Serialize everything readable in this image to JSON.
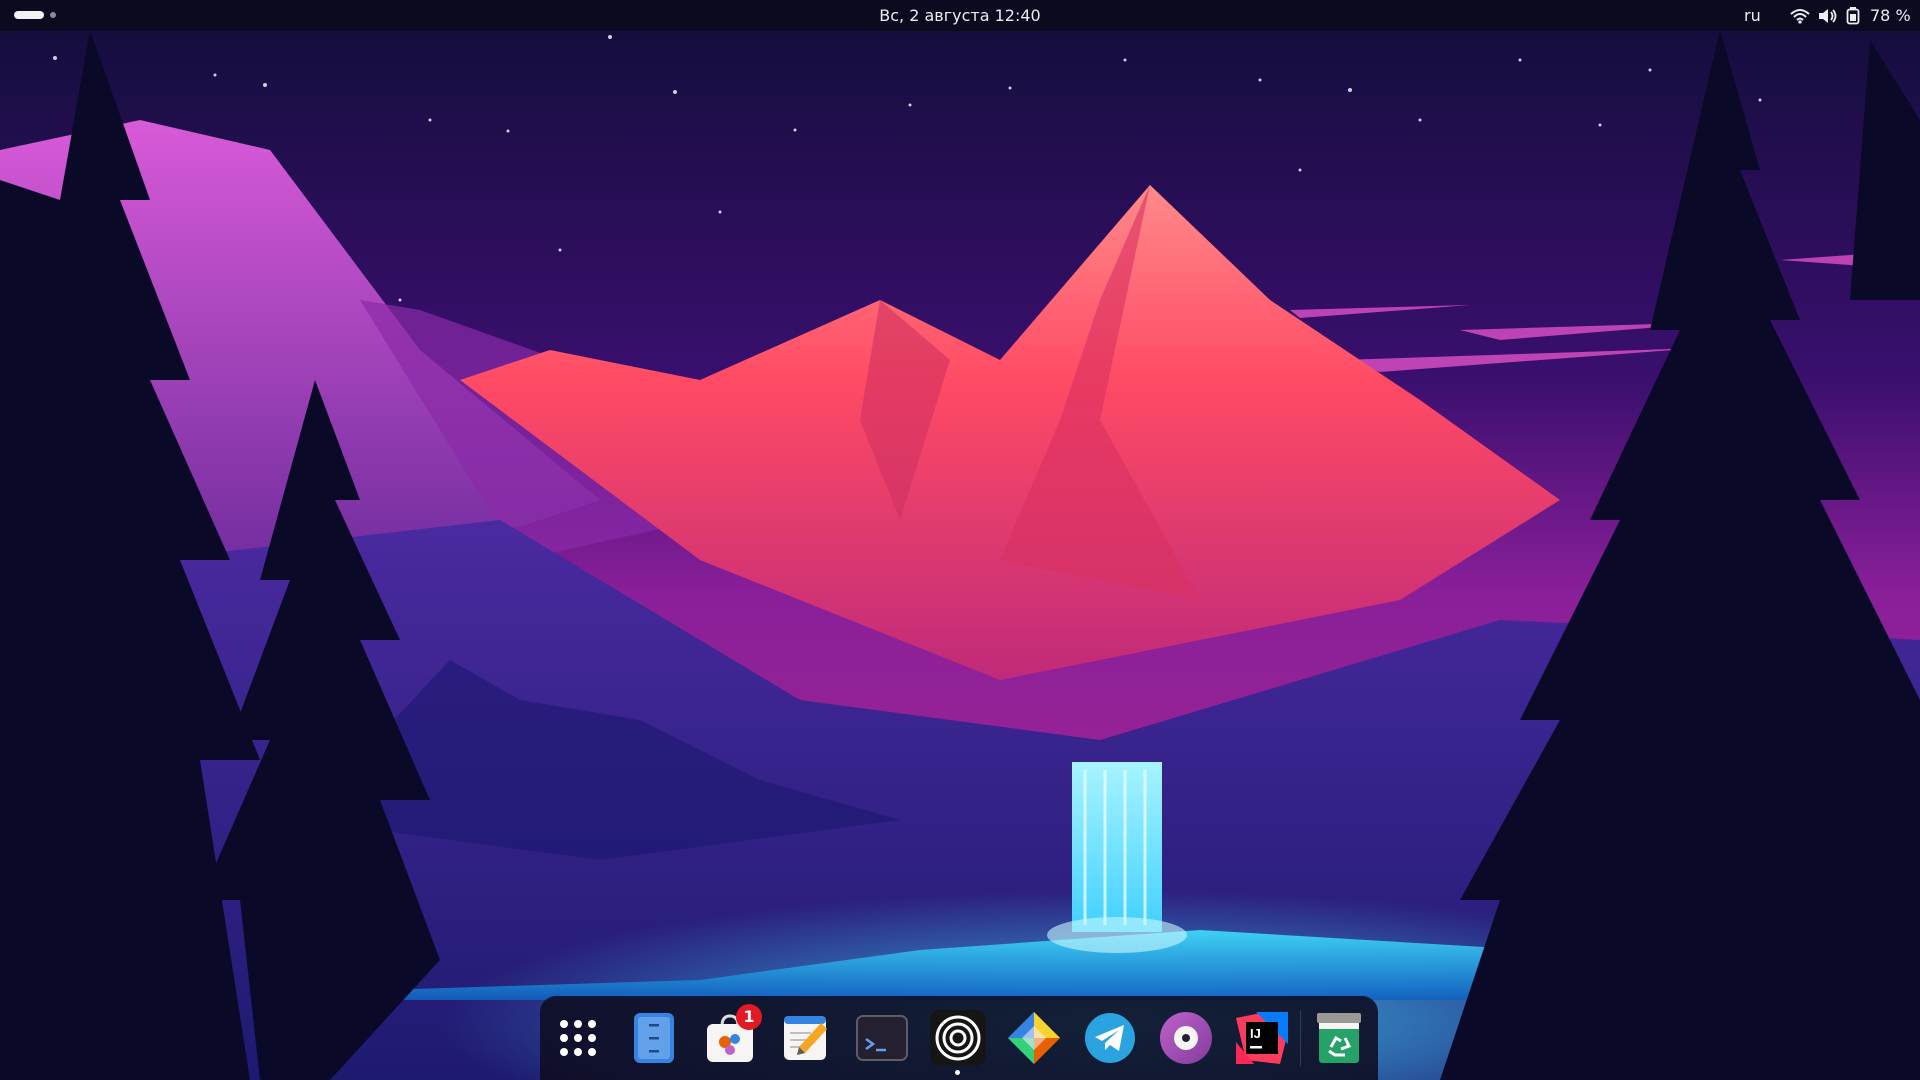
{
  "topbar": {
    "datetime": "Вс, 2 августа  12:40",
    "language": "ru",
    "battery_percent": "78 %",
    "workspaces": {
      "count": 2,
      "active": 1
    }
  },
  "wallpaper": {
    "description_colors": {
      "sky": "#2a0a5a",
      "mountain": "#f0405a",
      "water": "#20c8ff",
      "trees": "#0a0a25"
    }
  },
  "dock": {
    "apps": [
      {
        "name": "app-grid",
        "icon": "app-grid-icon"
      },
      {
        "name": "files",
        "icon": "files-icon"
      },
      {
        "name": "software-center",
        "icon": "store-bag-icon",
        "badge": "1"
      },
      {
        "name": "text-editor",
        "icon": "notepad-pencil-icon"
      },
      {
        "name": "terminal",
        "icon": "terminal-icon"
      },
      {
        "name": "obs-studio",
        "icon": "concentric-rings-icon",
        "running": true
      },
      {
        "name": "sketch-like-app",
        "icon": "gem-icon"
      },
      {
        "name": "telegram",
        "icon": "telegram-icon"
      },
      {
        "name": "music-player",
        "icon": "vinyl-disc-icon"
      },
      {
        "name": "intellij-idea",
        "icon": "intellij-icon"
      },
      {
        "name": "trash",
        "icon": "trash-icon"
      }
    ]
  }
}
